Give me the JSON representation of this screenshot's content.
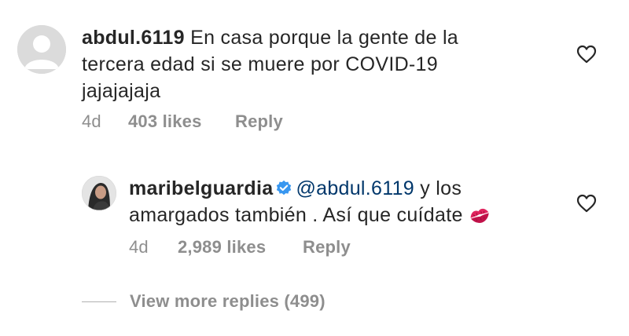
{
  "comments": [
    {
      "username": "abdul.6119",
      "text": "En casa porque la gente de la tercera edad si se muere por COVID-19 jajajajaja",
      "time": "4d",
      "likes": "403 likes",
      "reply_label": "Reply",
      "avatar_icon": "default-avatar-icon",
      "like_icon": "heart-outline-icon"
    },
    {
      "username": "maribelguardia",
      "verified_icon": "verified-badge-icon",
      "mention": "@abdul.6119",
      "text": " y los amargados también . Así que cuídate",
      "emoji": "kiss-mark-emoji",
      "time": "4d",
      "likes": "2,989 likes",
      "reply_label": "Reply",
      "like_icon": "heart-outline-icon"
    }
  ],
  "view_more_replies": "View more replies (499)",
  "colors": {
    "text": "#262626",
    "secondary": "#8e8e8e",
    "mention": "#00376b",
    "verified": "#3897f0",
    "avatar_placeholder": "#dbdbdb",
    "kiss": "#e0245e"
  }
}
